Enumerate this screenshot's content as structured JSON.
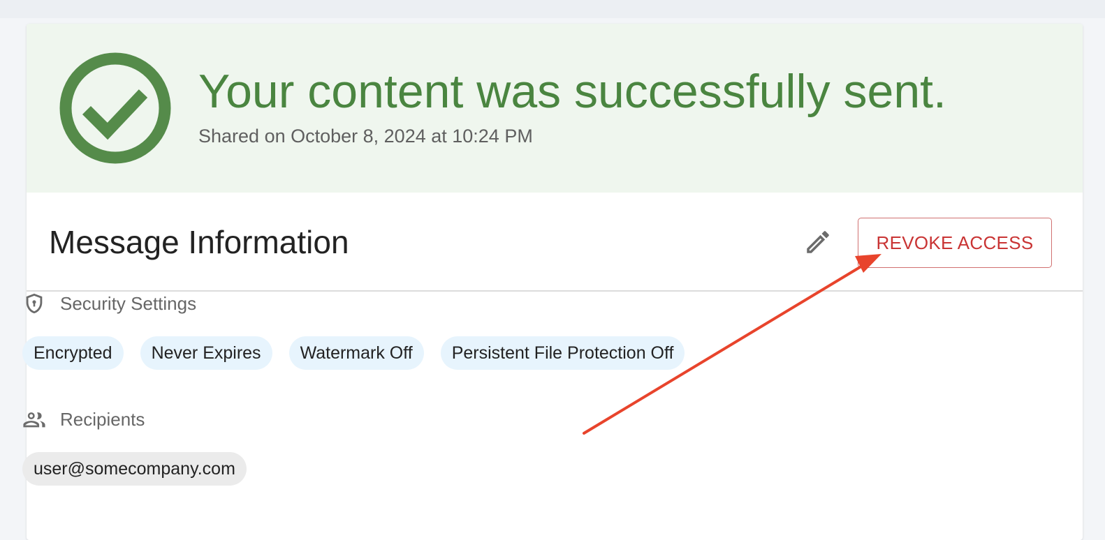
{
  "banner": {
    "title": "Your content was successfully sent.",
    "subtitle": "Shared on October 8, 2024 at 10:24 PM",
    "icon": "check-circle-icon",
    "color": "#4a8540"
  },
  "message_info": {
    "title": "Message Information",
    "edit_icon": "pencil-icon",
    "revoke_label": "REVOKE ACCESS",
    "revoke_color": "#c93434"
  },
  "security": {
    "heading": "Security Settings",
    "icon": "shield-lock-icon",
    "chips": [
      "Encrypted",
      "Never Expires",
      "Watermark Off",
      "Persistent File Protection Off"
    ]
  },
  "recipients": {
    "heading": "Recipients",
    "icon": "people-icon",
    "chips": [
      "user@somecompany.com"
    ]
  },
  "annotation": {
    "arrow_color": "#e8442c"
  }
}
